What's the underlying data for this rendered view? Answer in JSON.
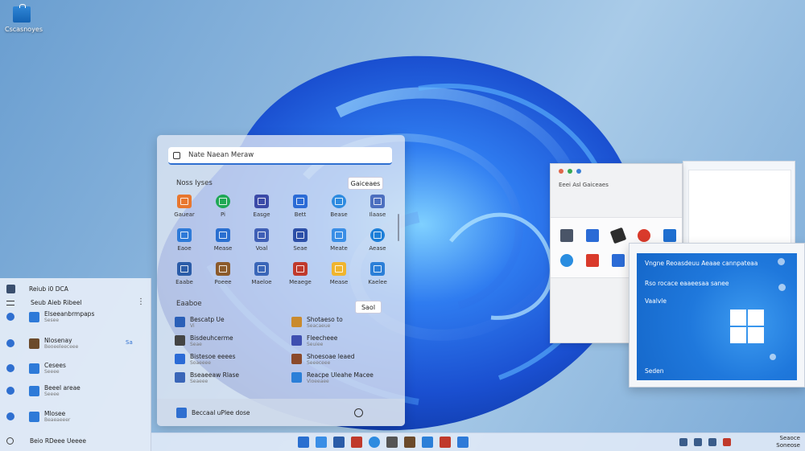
{
  "desktop": {
    "icon_label": "Cscasnoyes"
  },
  "start_menu": {
    "search_placeholder": "Nate Naean Meraw",
    "pinned_title": "Noss Iyses",
    "pinned_button": "Gaiceaes",
    "pinned_apps": [
      {
        "label": "Gauear",
        "color": "#e8772e",
        "icon": "app-icon"
      },
      {
        "label": "Pi",
        "color": "#1fa855",
        "icon": "app-icon",
        "round": true
      },
      {
        "label": "Easge",
        "color": "#3b4aa8",
        "icon": "app-icon"
      },
      {
        "label": "Bett",
        "color": "#2b6bd6",
        "icon": "app-icon"
      },
      {
        "label": "Bease",
        "color": "#2d8be0",
        "icon": "app-icon",
        "round": true
      },
      {
        "label": "Ilaase",
        "color": "#4c6fbf",
        "icon": "app-icon"
      },
      {
        "label": "Eaoe",
        "color": "#2e7ad8",
        "icon": "app-icon"
      },
      {
        "label": "Mease",
        "color": "#2a6fd0",
        "icon": "app-icon"
      },
      {
        "label": "Voal",
        "color": "#3f5fb6",
        "icon": "app-icon"
      },
      {
        "label": "Seae",
        "color": "#2c4fa8",
        "icon": "app-icon"
      },
      {
        "label": "Meate",
        "color": "#3a8ee6",
        "icon": "app-icon"
      },
      {
        "label": "Aease",
        "color": "#1d7fd8",
        "icon": "app-icon",
        "round": true
      },
      {
        "label": "Eaabe",
        "color": "#2b5ca8",
        "icon": "app-icon"
      },
      {
        "label": "Poeee",
        "color": "#8b5a2b",
        "icon": "app-icon"
      },
      {
        "label": "Maeloe",
        "color": "#3a66b8",
        "icon": "app-icon"
      },
      {
        "label": "Meaege",
        "color": "#c0392b",
        "icon": "app-icon"
      },
      {
        "label": "Mease",
        "color": "#f0b52e",
        "icon": "app-icon"
      },
      {
        "label": "Kaelee",
        "color": "#2b7fd8",
        "icon": "app-icon"
      }
    ],
    "recommended_title": "Eaaboe",
    "recommended_button": "Saol",
    "recommended": [
      {
        "title": "Bescatp Ue",
        "sub": "Vi",
        "color": "#2a5fb8"
      },
      {
        "title": "Shotaeso to",
        "sub": "Seacaeue",
        "color": "#c98a2e"
      },
      {
        "title": "Bisdeuhcerme",
        "sub": "Seae",
        "color": "#444"
      },
      {
        "title": "Fleecheee",
        "sub": "Seuiee",
        "color": "#3f4fb0"
      },
      {
        "title": "Bistesoe eeees",
        "sub": "Soaeeee",
        "color": "#2b6bd6"
      },
      {
        "title": "Shoesoae leaed",
        "sub": "Seeeceee",
        "color": "#8b4a2b"
      },
      {
        "title": "Bseaeeaw Rlase",
        "sub": "Seaeee",
        "color": "#3a66b8"
      },
      {
        "title": "Reacpe Uleahe Macee",
        "sub": "Vioeeaee",
        "color": "#2b7fd8"
      }
    ],
    "footer_label": "Beccaal uPlee dose"
  },
  "left_panel": {
    "header": "Reiub i0 DCA",
    "sub_header": "Seub Aieb Ribeel",
    "items": [
      {
        "title": "Elseeanbrmpaps",
        "sub": "Sesee",
        "color": "#2e7ad8"
      },
      {
        "title": "Nlosenay",
        "sub": "Beoeeleeceee",
        "color": "#6b4a2b"
      },
      {
        "title": "Cesees",
        "sub": "Seeee",
        "color": "#2e7ad8"
      },
      {
        "title": "Beeel areae",
        "sub": "Seeee",
        "color": "#2e7ad8"
      },
      {
        "title": "Mlosee",
        "sub": "Beaeaeeer",
        "color": "#2e7ad8"
      }
    ],
    "item2_badge": "Sa",
    "footer": "Beio RDeee Ueeee"
  },
  "window_back": {
    "title": "Eeei Asl Gaiceaes"
  },
  "window_front": {
    "lines": [
      "Vngne Reoasdeuu Aeaae cannpateaa",
      "Rso rocace eaaeesaa sanee",
      "Vaalvle"
    ],
    "footer": "Seden"
  },
  "taskbar": {
    "icons": [
      {
        "color": "#2a6fd0"
      },
      {
        "color": "#3a8ee6"
      },
      {
        "color": "#2b5ca8"
      },
      {
        "color": "#c0392b"
      },
      {
        "color": "#2d8be0",
        "round": true
      },
      {
        "color": "#555"
      },
      {
        "color": "#6b4a2b"
      },
      {
        "color": "#2b7fd8"
      },
      {
        "color": "#c0392b"
      },
      {
        "color": "#2e7ad8"
      }
    ],
    "clock_time": "Seaoce",
    "clock_date": "Soneose"
  }
}
